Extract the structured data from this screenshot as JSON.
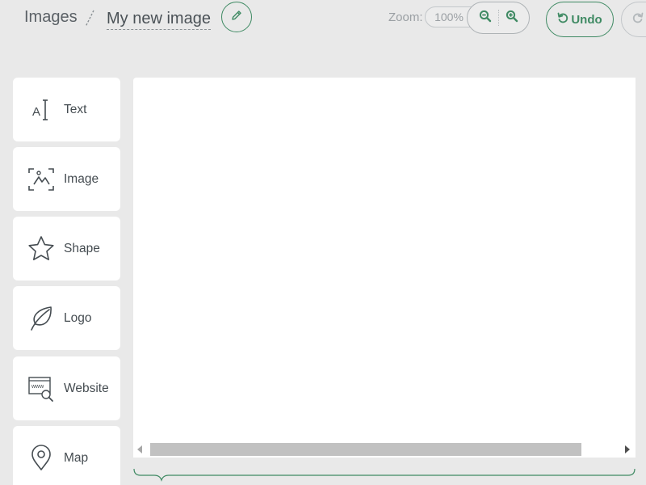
{
  "header": {
    "breadcrumb_root": "Images",
    "document_title": "My new image",
    "edit_icon": "pencil-icon",
    "zoom_label": "Zoom:",
    "zoom_value": "100%",
    "zoom_out_icon": "zoom-out-icon",
    "zoom_in_icon": "zoom-in-icon",
    "undo_label": "Undo",
    "undo_icon": "undo-icon",
    "redo_icon": "redo-icon"
  },
  "sidebar": {
    "items": [
      {
        "label": "Text",
        "icon": "text-cursor-icon"
      },
      {
        "label": "Image",
        "icon": "image-scan-icon"
      },
      {
        "label": "Shape",
        "icon": "star-icon"
      },
      {
        "label": "Logo",
        "icon": "leaf-icon"
      },
      {
        "label": "Website",
        "icon": "website-icon"
      },
      {
        "label": "Map",
        "icon": "map-pin-icon"
      }
    ]
  },
  "colors": {
    "accent": "#3f8a63",
    "background": "#e9e9e9",
    "panel": "#ffffff",
    "text": "#454c51"
  }
}
